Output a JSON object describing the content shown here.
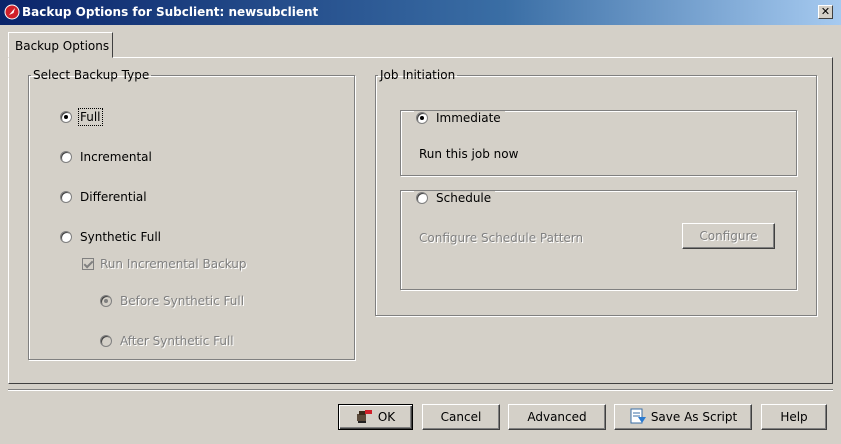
{
  "window": {
    "title": "Backup Options for Subclient: newsubclient",
    "close_label": "✕"
  },
  "tabs": [
    {
      "label": "Backup Options"
    }
  ],
  "backup_type": {
    "legend": "Select Backup Type",
    "options": [
      {
        "label": "Full",
        "checked": true,
        "enabled": true
      },
      {
        "label": "Incremental",
        "checked": false,
        "enabled": true
      },
      {
        "label": "Differential",
        "checked": false,
        "enabled": true
      },
      {
        "label": "Synthetic Full",
        "checked": false,
        "enabled": true
      }
    ],
    "run_incremental": {
      "label": "Run Incremental Backup",
      "checked": true,
      "enabled": false
    },
    "synthetic_timing": [
      {
        "label": "Before Synthetic Full",
        "checked": true,
        "enabled": false
      },
      {
        "label": "After Synthetic Full",
        "checked": false,
        "enabled": false
      }
    ]
  },
  "job_initiation": {
    "legend": "Job Initiation",
    "immediate": {
      "label": "Immediate",
      "checked": true,
      "description": "Run this job now"
    },
    "schedule": {
      "label": "Schedule",
      "checked": false,
      "description": "Configure Schedule Pattern",
      "configure_label": "Configure"
    }
  },
  "footer": {
    "ok_label": "OK",
    "cancel_label": "Cancel",
    "advanced_label": "Advanced",
    "save_script_label": "Save As Script",
    "help_label": "Help"
  },
  "colors": {
    "dialog_bg": "#d4d0c8",
    "title_bar": "#0a246a",
    "disabled_text": "#808080"
  }
}
